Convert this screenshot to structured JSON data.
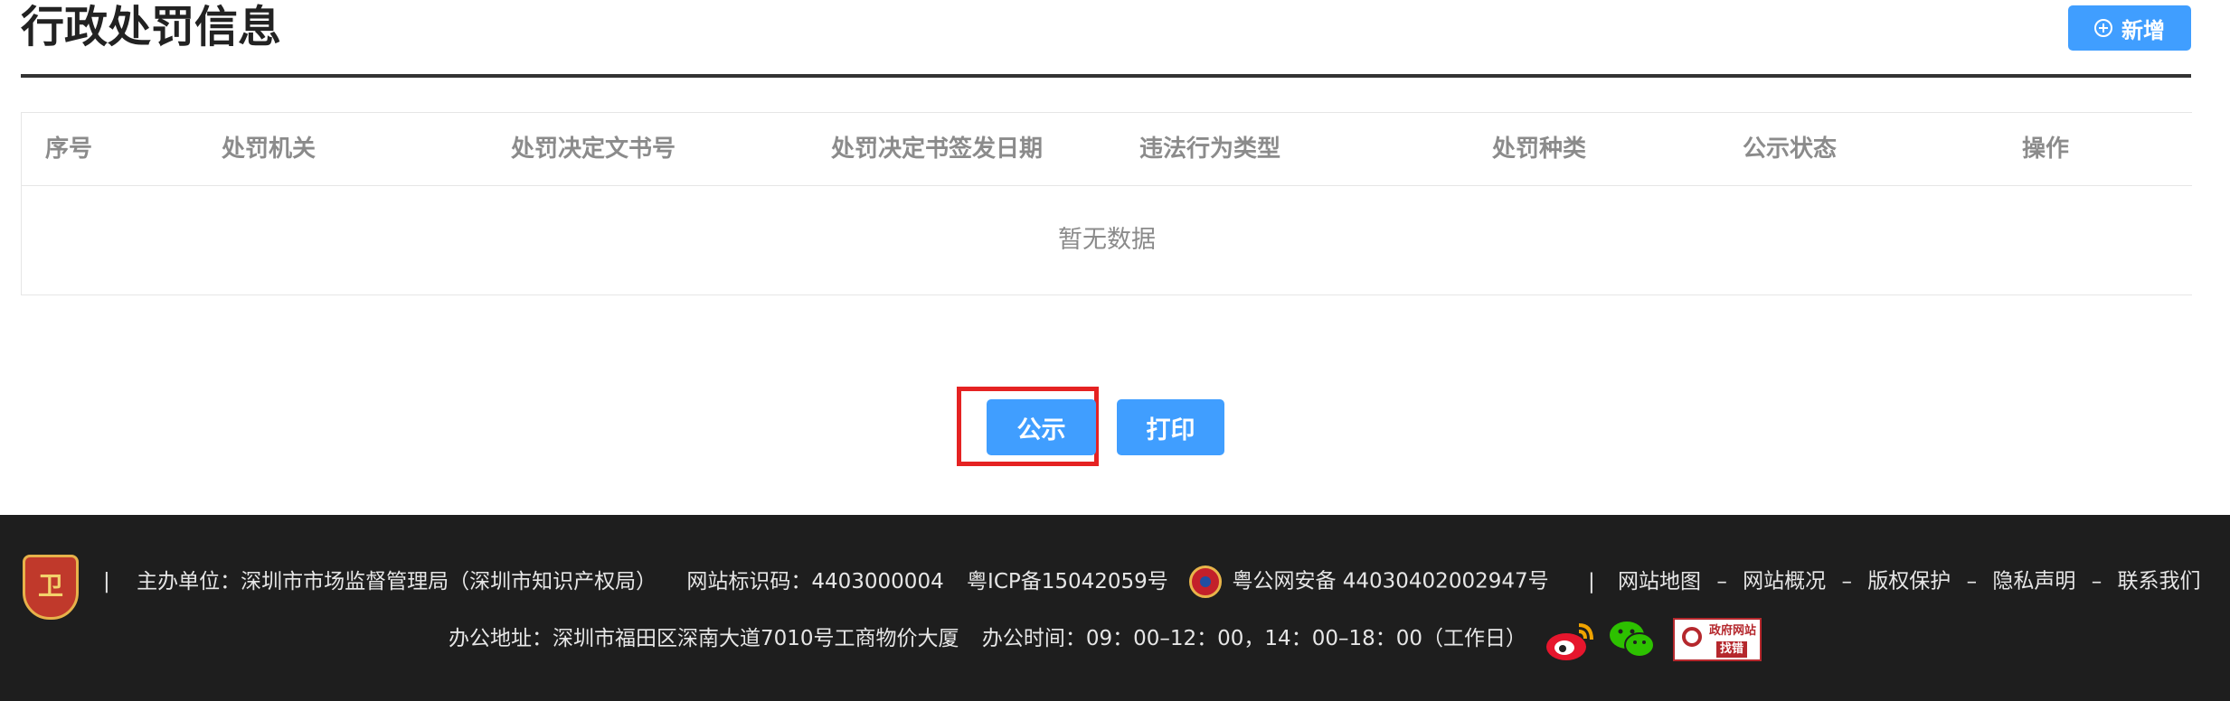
{
  "header": {
    "title": "行政处罚信息",
    "add_label": "新增"
  },
  "table": {
    "columns": [
      "序号",
      "处罚机关",
      "处罚决定文书号",
      "处罚决定书签发日期",
      "违法行为类型",
      "处罚种类",
      "公示状态",
      "操作"
    ],
    "empty_text": "暂无数据"
  },
  "actions": {
    "publish_label": "公示",
    "print_label": "打印"
  },
  "footer": {
    "row1_sep": "|",
    "sponsor": "主办单位：深圳市市场监督管理局（深圳市知识产权局）",
    "site_code": "网站标识码：4403000004",
    "icp": "粤ICP备15042059号",
    "police_record": "粤公网安备 44030402002947号",
    "links": [
      "网站地图",
      "网站概况",
      "版权保护",
      "隐私声明",
      "联系我们"
    ],
    "link_sep": "–",
    "address": "办公地址：深圳市福田区深南大道7010号工商物价大厦",
    "hours": "办公时间：09：00–12：00，14：00–18：00（工作日）",
    "gov_badge_line1": "政府网站",
    "gov_badge_line2": "找错"
  }
}
